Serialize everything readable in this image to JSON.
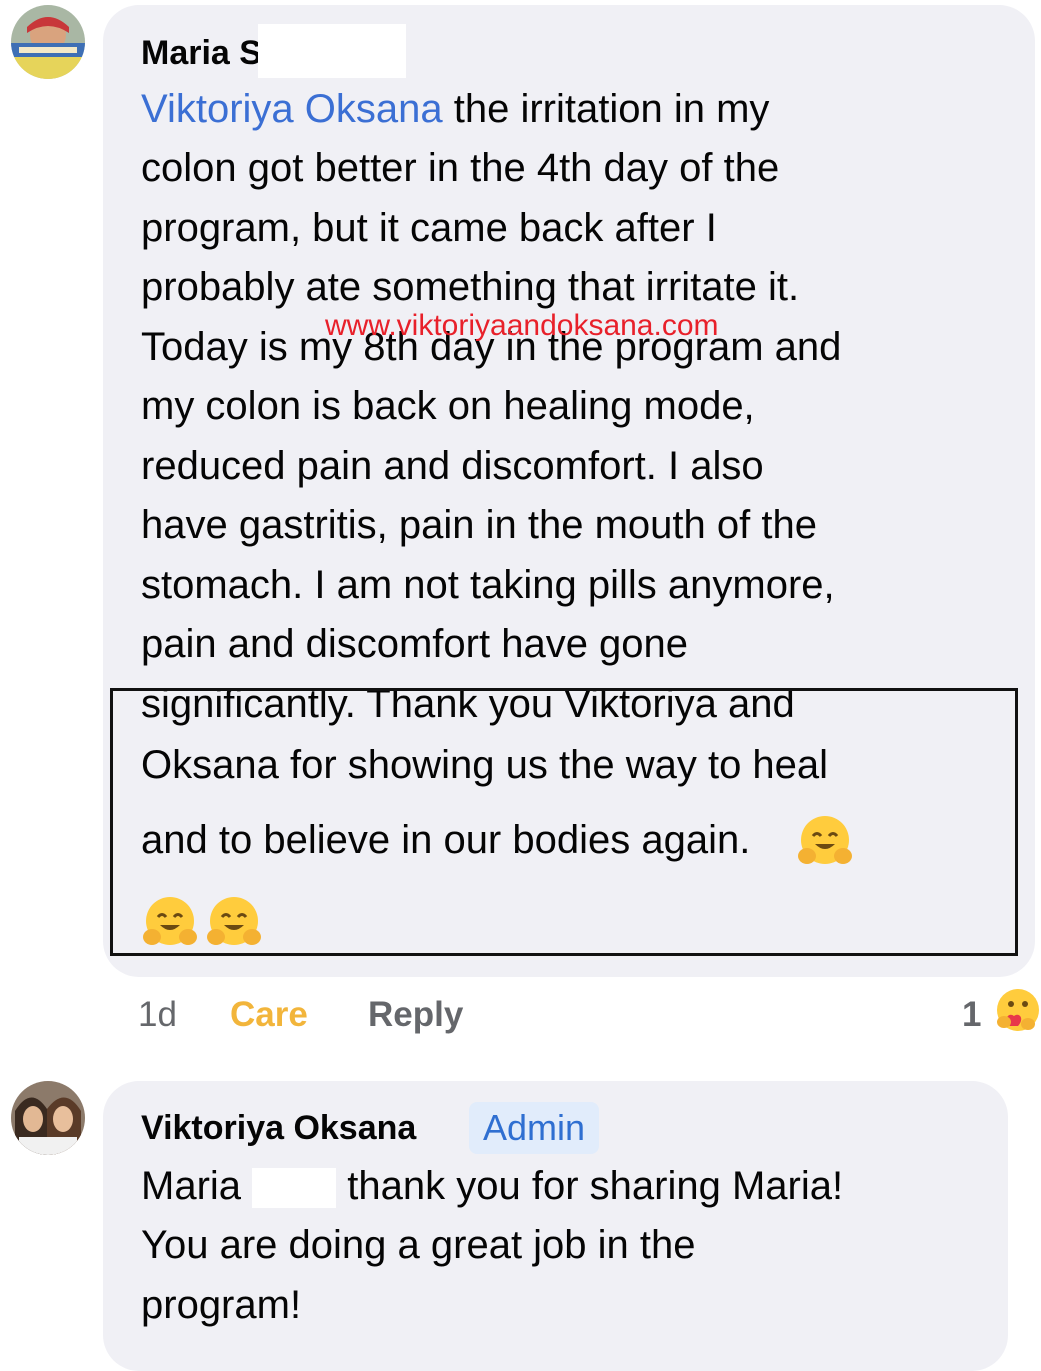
{
  "comment1": {
    "author": "Maria S",
    "mention": "Viktoriya Oksana",
    "lines": [
      " the irritation in my",
      "colon got better in the 4th day of the",
      "program, but it came back after I",
      "probably ate something that irritate it.",
      "Today is my 8th day in the program and",
      "my colon is back on healing mode,",
      "reduced pain and discomfort. I also",
      "have gastritis, pain in the mouth of the",
      "stomach.  I am not taking pills anymore,",
      "pain and discomfort have gone",
      "significantly.  Thank you Viktoriya and",
      "Oksana for showing us the way to heal",
      "and to believe in our bodies again."
    ],
    "emojis": [
      "hugging-face-emoji",
      "hugging-face-emoji",
      "hugging-face-emoji"
    ],
    "time": "1d",
    "reaction_label": "Care",
    "reply_label": "Reply",
    "reaction_count": "1",
    "reaction_icon": "care-reaction-icon"
  },
  "watermark": "www.viktoriyaandoksana.com",
  "comment2": {
    "author": "Viktoriya Oksana",
    "badge": "Admin",
    "first_name": "Maria",
    "lines": [
      "thank you for sharing Maria!",
      "You are doing a great job in the",
      "program!"
    ]
  },
  "colors": {
    "bubble": "#f0f0f5",
    "mention": "#3b6fd4",
    "care": "#f2b53b",
    "action_gray": "#65676b",
    "badge_bg": "#e1ecfb",
    "badge_text": "#2f6fd1",
    "watermark": "#e8202a"
  }
}
